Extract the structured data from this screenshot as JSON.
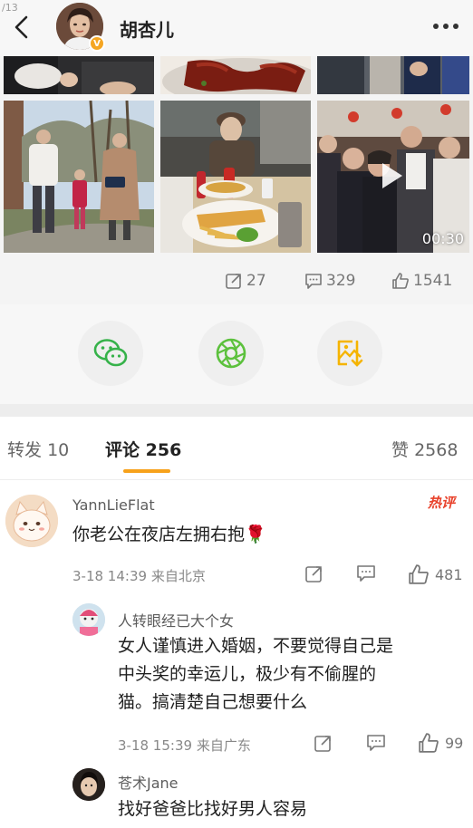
{
  "status": {
    "fragment": "/13"
  },
  "header": {
    "name": "胡杏儿",
    "verified_badge": "V"
  },
  "media": {
    "video_duration": "00:30"
  },
  "stats": {
    "reposts": "27",
    "comments": "329",
    "likes": "1541"
  },
  "share": {
    "items": [
      "wechat-icon",
      "moments-icon",
      "save-image-icon"
    ]
  },
  "tabs": [
    {
      "label": "转发",
      "count": "10",
      "active": false
    },
    {
      "label": "评论",
      "count": "256",
      "active": true
    },
    {
      "label": "赞",
      "count": "2568",
      "active": false
    }
  ],
  "comments": [
    {
      "user": "YannLieFlat",
      "text": "你老公在夜店左拥右抱🌹",
      "time": "3-18 14:39",
      "location": "来自北京",
      "likes": "481",
      "badge": "热评"
    },
    {
      "user": "人转眼经已大个女",
      "text_lines": [
        "女人谨慎进入婚姻，不要觉得自己是",
        "中头奖的幸运儿，极少有不偷腥的",
        "猫。搞清楚自己想要什么"
      ],
      "time": "3-18 15:39",
      "location": "来自广东",
      "likes": "99"
    },
    {
      "user": "苍术Jane",
      "text": "找好爸爸比找好男人容易"
    }
  ],
  "colors": {
    "accent": "#f7a21b",
    "hot": "#e8412a",
    "wechat": "#36b24a",
    "moments": "#5cc13d",
    "save": "#f5b400"
  }
}
